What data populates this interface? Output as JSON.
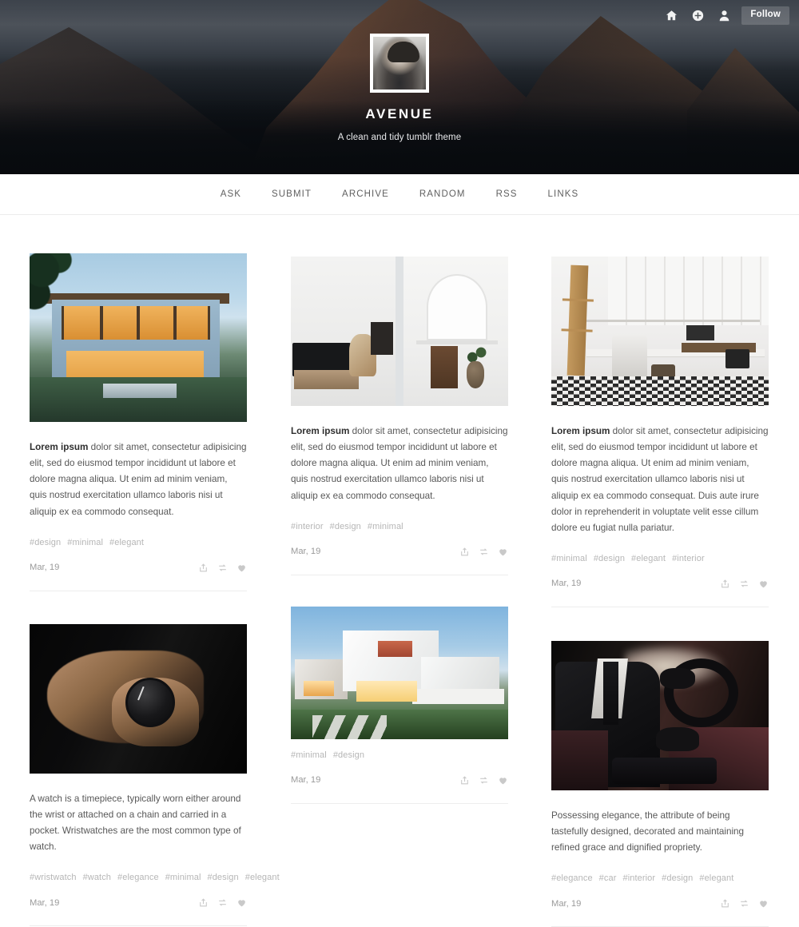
{
  "header": {
    "icons": [
      {
        "name": "home-icon",
        "label": "Home"
      },
      {
        "name": "add-post-icon",
        "label": "New post"
      },
      {
        "name": "account-icon",
        "label": "Account"
      }
    ],
    "follow_label": "Follow",
    "site_title": "AVENUE",
    "site_description": "A clean and tidy tumblr theme",
    "avatar_alt": "Blog avatar portrait"
  },
  "nav": {
    "items": [
      {
        "label": "ASK"
      },
      {
        "label": "SUBMIT"
      },
      {
        "label": "ARCHIVE"
      },
      {
        "label": "RANDOM"
      },
      {
        "label": "RSS"
      },
      {
        "label": "LINKS"
      }
    ]
  },
  "actions": {
    "share": "share-icon",
    "reblog": "reblog-icon",
    "like": "heart-icon"
  },
  "columns": [
    {
      "posts": [
        {
          "photo": "blue-modern-house-at-dusk",
          "lead": "Lorem ipsum",
          "text": " dolor sit amet, consectetur adipisicing elit, sed do eiusmod tempor incididunt ut labore et dolore magna aliqua. Ut enim ad minim veniam, quis nostrud exercitation ullamco laboris nisi ut aliquip ex ea commodo consequat.",
          "tags": [
            "#design",
            "#minimal",
            "#elegant"
          ],
          "date": "Mar, 19"
        },
        {
          "photo": "hand-holding-black-wristwatch",
          "lead": "",
          "text": "A watch is a timepiece, typically worn either around the wrist or attached on a chain and carried in a pocket. Wristwatches are the most common type of watch.",
          "tags": [
            "#wristwatch",
            "#watch",
            "#elegance",
            "#minimal",
            "#design",
            "#elegant"
          ],
          "date": "Mar, 19"
        }
      ]
    },
    {
      "posts": [
        {
          "photo": "split-white-interior-living-room-and-desk",
          "lead": "Lorem ipsum",
          "text": " dolor sit amet, consectetur adipisicing elit, sed do eiusmod tempor incididunt ut labore et dolore magna aliqua. Ut enim ad minim veniam, quis nostrud exercitation ullamco laboris nisi ut aliquip ex ea commodo consequat.",
          "tags": [
            "#interior",
            "#design",
            "#minimal"
          ],
          "date": "Mar, 19"
        },
        {
          "photo": "white-modern-villa-at-twilight",
          "lead": "",
          "text": "",
          "tags": [
            "#minimal",
            "#design"
          ],
          "date": "Mar, 19"
        }
      ]
    },
    {
      "posts": [
        {
          "photo": "white-kitchen-with-ladder-and-tiled-floor",
          "lead": "Lorem ipsum",
          "text": " dolor sit amet, consectetur adipisicing elit, sed do eiusmod tempor incididunt ut labore et dolore magna aliqua. Ut enim ad minim veniam, quis nostrud exercitation ullamco laboris nisi ut aliquip ex ea commodo consequat. Duis aute irure dolor in reprehenderit in voluptate velit esse cillum dolore eu fugiat nulla pariatur.",
          "tags": [
            "#minimal",
            "#design",
            "#elegant",
            "#interior"
          ],
          "date": "Mar, 19"
        },
        {
          "photo": "man-in-suit-driving-luxury-car",
          "lead": "",
          "text": "Possessing elegance, the attribute of being tastefully designed, decorated and maintaining refined grace and dignified propriety.",
          "tags": [
            "#elegance",
            "#car",
            "#interior",
            "#design",
            "#elegant"
          ],
          "date": "Mar, 19"
        }
      ]
    }
  ],
  "colors": {
    "page_background": "#ffffff",
    "header_background": "#0d1116",
    "nav_text": "#5f5f5f",
    "body_text": "#585858",
    "tag_text": "#b6b6b6",
    "date_text": "#9a9a9a",
    "divider": "#ededed"
  }
}
